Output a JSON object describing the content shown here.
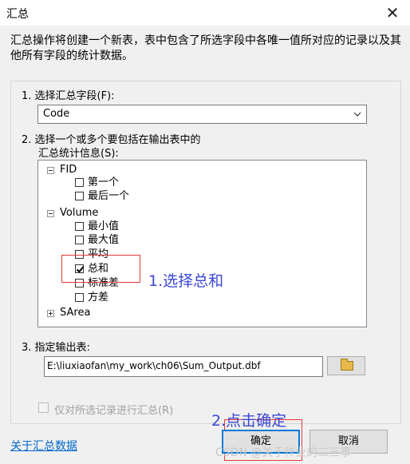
{
  "window": {
    "title": "汇总",
    "close_glyph": "✕"
  },
  "description": "汇总操作将创建一个新表，表中包含了所选字段中各唯一值所对应的记录以及其他所有字段的统计数据。",
  "step1": {
    "label": "1. 选择汇总字段(F):",
    "selected": "Code"
  },
  "step2": {
    "label_line1": "2. 选择一个或多个要包括在输出表中的",
    "label_line2": "汇总统计信息(S):"
  },
  "tree": {
    "fid": {
      "label": "FID",
      "children": [
        {
          "label": "第一个",
          "checked": false
        },
        {
          "label": "最后一个",
          "checked": false
        }
      ]
    },
    "volume": {
      "label": "Volume",
      "children": [
        {
          "label": "最小值",
          "checked": false
        },
        {
          "label": "最大值",
          "checked": false
        },
        {
          "label": "平均",
          "checked": false
        },
        {
          "label": "总和",
          "checked": true
        },
        {
          "label": "标准差",
          "checked": false
        },
        {
          "label": "方差",
          "checked": false
        }
      ]
    },
    "sarea": {
      "label": "SArea"
    }
  },
  "annotations": {
    "step1_text": "1.选择总和",
    "step2_text": "2.点击确定",
    "color_box": "#e53935",
    "color_text": "#3b47d4"
  },
  "step3": {
    "label": "3. 指定输出表:",
    "path": "E:\\liuxiaofan\\my_work\\ch06\\Sum_Output.dbf"
  },
  "selected_only": {
    "label": "仅对所选记录进行汇总(R)",
    "checked": false,
    "enabled": false
  },
  "footer": {
    "link": "关于汇总数据",
    "ok": "确定",
    "cancel": "取消"
  },
  "watermark": "CSDN @关于作业的二三事"
}
